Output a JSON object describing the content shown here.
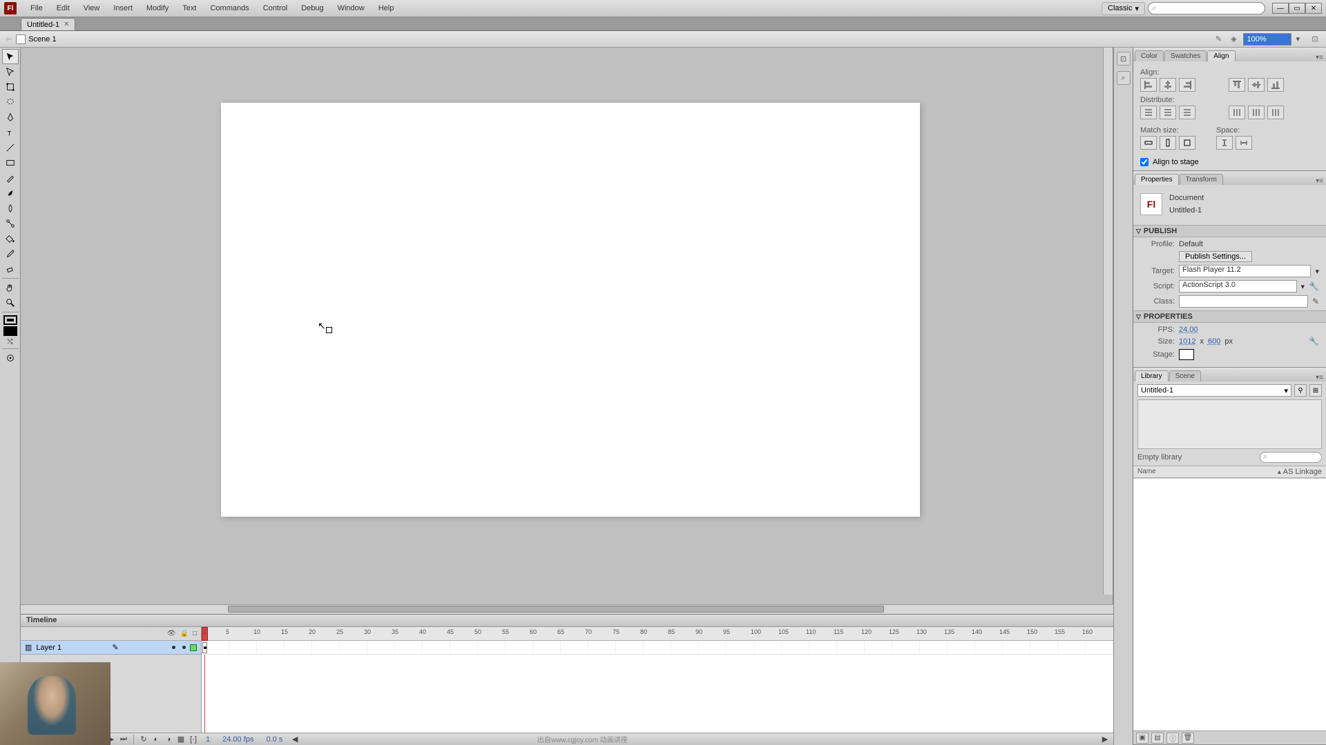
{
  "menu": {
    "items": [
      "File",
      "Edit",
      "View",
      "Insert",
      "Modify",
      "Text",
      "Commands",
      "Control",
      "Debug",
      "Window",
      "Help"
    ]
  },
  "workspace": "Classic",
  "doc_tab": "Untitled-1",
  "scene": "Scene 1",
  "zoom": "100%",
  "align_panel": {
    "tabs": [
      "Color",
      "Swatches",
      "Align"
    ],
    "active": 2,
    "labels": {
      "align": "Align:",
      "distribute": "Distribute:",
      "match": "Match size:",
      "space": "Space:",
      "align_stage": "Align to stage"
    }
  },
  "props_panel": {
    "tabs": [
      "Properties",
      "Transform"
    ],
    "active": 0,
    "doc_type": "Document",
    "doc_name": "Untitled-1",
    "sections": {
      "publish": "PUBLISH",
      "properties": "PROPERTIES"
    },
    "publish": {
      "profile_label": "Profile:",
      "profile_value": "Default",
      "settings_btn": "Publish Settings...",
      "target_label": "Target:",
      "target_value": "Flash Player 11.2",
      "script_label": "Script:",
      "script_value": "ActionScript 3.0",
      "class_label": "Class:",
      "class_value": ""
    },
    "properties": {
      "fps_label": "FPS:",
      "fps_value": "24.00",
      "size_label": "Size:",
      "size_w": "1012",
      "size_x": "x",
      "size_h": "600",
      "size_unit": "px",
      "stage_label": "Stage:"
    }
  },
  "library_panel": {
    "tabs": [
      "Library",
      "Scene"
    ],
    "active": 0,
    "doc_select": "Untitled-1",
    "count": "Empty library",
    "col_name": "Name",
    "col_linkage": "AS Linkage"
  },
  "timeline": {
    "title": "Timeline",
    "layer": "Layer 1",
    "ruler": [
      1,
      5,
      10,
      15,
      20,
      25,
      30,
      35,
      40,
      45,
      50,
      55,
      60,
      65,
      70,
      75,
      80,
      85,
      90,
      95,
      100,
      105,
      110,
      115,
      120,
      125,
      130,
      135,
      140,
      145,
      150,
      155,
      160
    ],
    "frame": "1",
    "fps": "24.00 fps",
    "time": "0.0 s",
    "watermark": "出自www.cgjoy.com  动画讲座"
  }
}
